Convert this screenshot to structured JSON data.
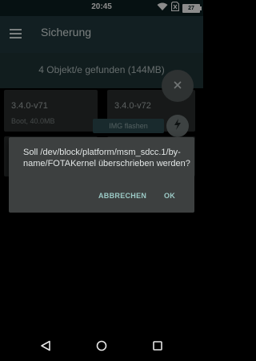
{
  "status_bar": {
    "time": "20:45",
    "battery": "27",
    "icons": [
      "wifi-icon",
      "no-sim-icon",
      "battery-charging-icon"
    ]
  },
  "app_bar": {
    "title": "Sicherung",
    "menu_icon": "hamburger-menu-icon"
  },
  "header": {
    "found_text": "4 Objekt/e gefunden (144MB)"
  },
  "backups": [
    {
      "name": "3.4.0-v71",
      "info": "Boot, 40.0MB"
    },
    {
      "name": "3.4.0-v72",
      "info": ""
    }
  ],
  "flash_chip": {
    "label": "IMG flashen"
  },
  "fabs": {
    "close_icon": "close-icon",
    "flash_icon": "lightning-bolt-icon"
  },
  "dialog": {
    "message": "Soll /dev/block/platform/msm_sdcc.1/by-name/FOTAKernel überschrieben werden?",
    "cancel_label": "ABBRECHEN",
    "ok_label": "OK"
  },
  "nav_bar": {
    "icons": [
      "back-triangle-icon",
      "home-circle-icon",
      "recents-square-icon"
    ]
  },
  "colors": {
    "app_bar": "#223a3e",
    "accent": "#9ccac6",
    "dialog_bg": "#3d4040"
  }
}
